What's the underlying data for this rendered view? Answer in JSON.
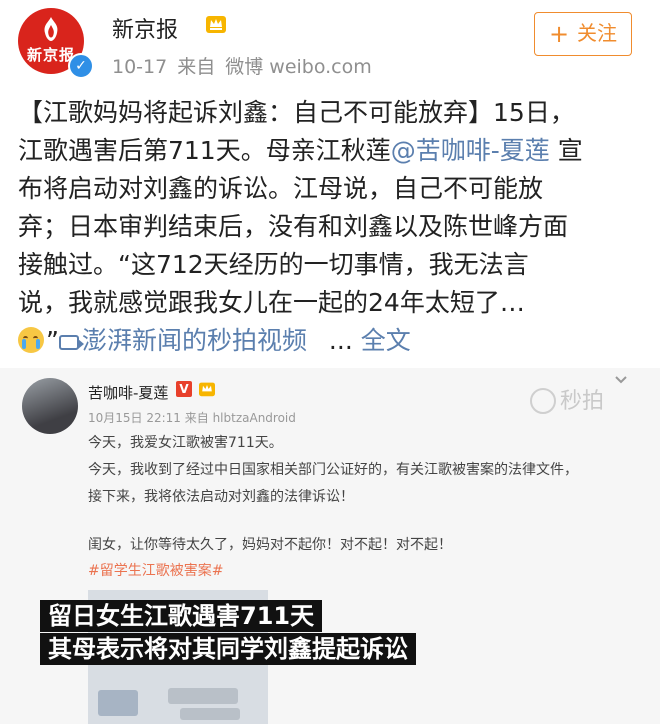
{
  "header": {
    "account_name": "新京报",
    "avatar_text": "新京报",
    "date": "10-17",
    "source_prefix": "来自",
    "source": "微博 weibo.com",
    "follow_label": "关注",
    "verified": "✓"
  },
  "post": {
    "lines": [
      "【江歌妈妈将起诉刘鑫：自己不可能放弃】15日，",
      "江歌遇害后第711天。母亲江秋莲",
      "布将启动对刘鑫的诉讼。江母说，自己不可能放",
      "弃；日本审判结束后，没有和刘鑫以及陈世峰方面",
      "接触过。“这712天经历的一切事情，我无法言",
      "说，我就感觉跟我女儿在一起的24年太短了…"
    ],
    "mention": "@苦咖啡-夏莲",
    "line2_tail": " 宣",
    "quote_close": "”",
    "video_link": "澎湃新闻的秒拍视频",
    "ellipsis": "...",
    "full_text_link": "全文"
  },
  "video": {
    "inner_name": "苦咖啡-夏莲",
    "v_badge": "V",
    "inner_meta": "10月15日 22:11 来自 hlbtzaAndroid",
    "watermark": "秒拍",
    "inner_lines": [
      "今天，我爱女江歌被害711天。",
      "今天，我收到了经过中日国家相关部门公证好的，有关江歌被害案的法律文件，",
      "接下来，我将依法启动对刘鑫的法律诉讼！",
      "闺女，让你等待太久了，妈妈对不起你！对不起！对不起！"
    ],
    "hashtag": "#留学生江歌被害案#",
    "captions": [
      "留日女生江歌遇害711天",
      "其母表示将对其同学刘鑫提起诉讼"
    ]
  },
  "colors": {
    "link": "#5b7fae",
    "follow": "#f08c2e",
    "brand_red": "#d9241c"
  }
}
